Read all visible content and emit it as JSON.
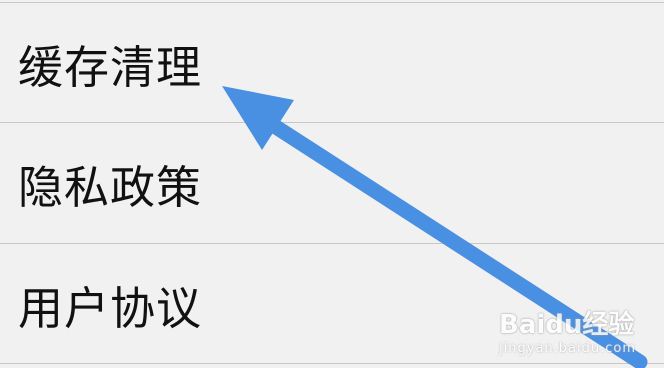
{
  "menu": {
    "items": [
      {
        "label": "缓存清理"
      },
      {
        "label": "隐私政策"
      },
      {
        "label": "用户协议"
      }
    ]
  },
  "annotation": {
    "arrow_color": "#4a90e2",
    "arrow_icon": "arrow-up-left-icon"
  },
  "watermark": {
    "logo": "Baidu经验",
    "url": "jingyan.baidu.com"
  }
}
